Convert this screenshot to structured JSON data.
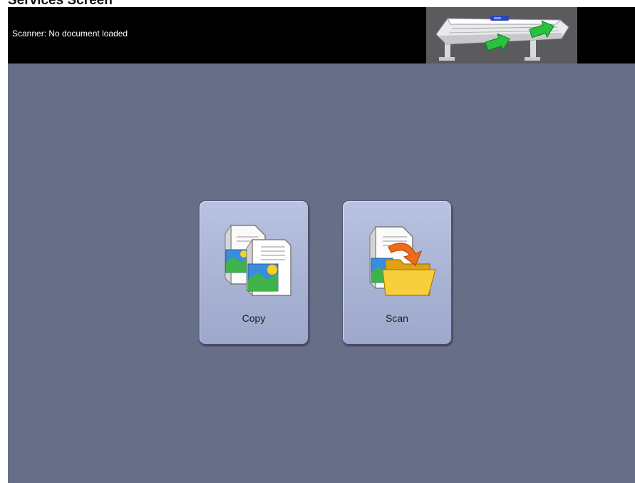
{
  "page": {
    "heading": "Services Screen"
  },
  "status_bar": {
    "status_text": "Scanner: No document loaded",
    "illustration_icon": "wide-format-scanner-load-icon"
  },
  "services": [
    {
      "label": "Copy",
      "icon": "copy-document-icon"
    },
    {
      "label": "Scan",
      "icon": "scan-to-folder-icon"
    }
  ],
  "colors": {
    "background": "#676e88",
    "topbar": "#000000",
    "tile": "#aab4d5",
    "arrow_green": "#22c03a",
    "folder_yellow": "#f2c42b",
    "arrow_orange": "#ea6a17"
  }
}
